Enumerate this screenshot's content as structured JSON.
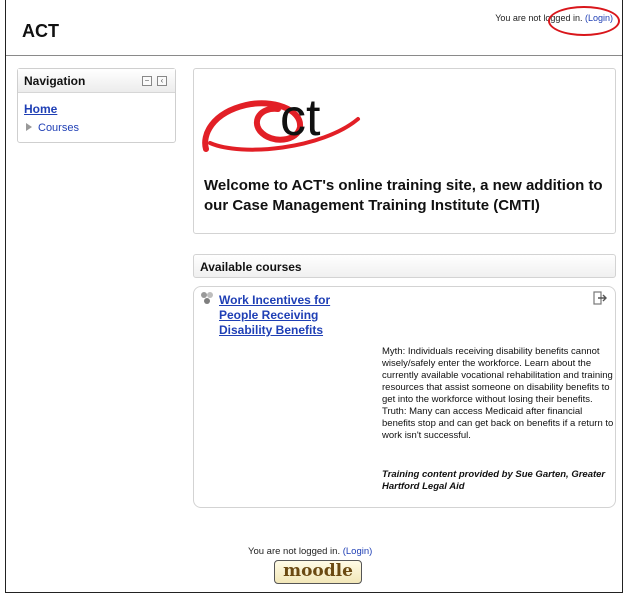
{
  "header": {
    "site_title": "ACT",
    "login_prefix": "You are not logged in.",
    "login_link": "(Login)"
  },
  "navigation": {
    "title": "Navigation",
    "home": "Home",
    "courses": "Courses"
  },
  "welcome": {
    "logo_text": "ct",
    "message": "Welcome to ACT's online training site, a new addition to our Case Management Training Institute (CMTI)"
  },
  "available_courses": {
    "title": "Available courses",
    "courses": [
      {
        "title": "Work Incentives for People Receiving Disability Benefits",
        "summary": "Myth: Individuals receiving disability benefits cannot wisely/safely enter the workforce. Learn about the currently available vocational rehabilitation and training resources that assist someone on disability benefits to get into the workforce without losing their benefits. Truth: Many can access Medicaid after financial benefits stop and can get back on benefits if a return to work isn't successful.",
        "credit": "Training content provided by Sue Garten, Greater Hartford Legal Aid"
      }
    ]
  },
  "footer": {
    "login_prefix": "You are not logged in.",
    "login_link": "(Login)",
    "moodle_label": "moodle"
  },
  "colors": {
    "link": "#1f3fb5",
    "logo_red": "#e21f26",
    "highlight_circle": "#d9161b"
  }
}
